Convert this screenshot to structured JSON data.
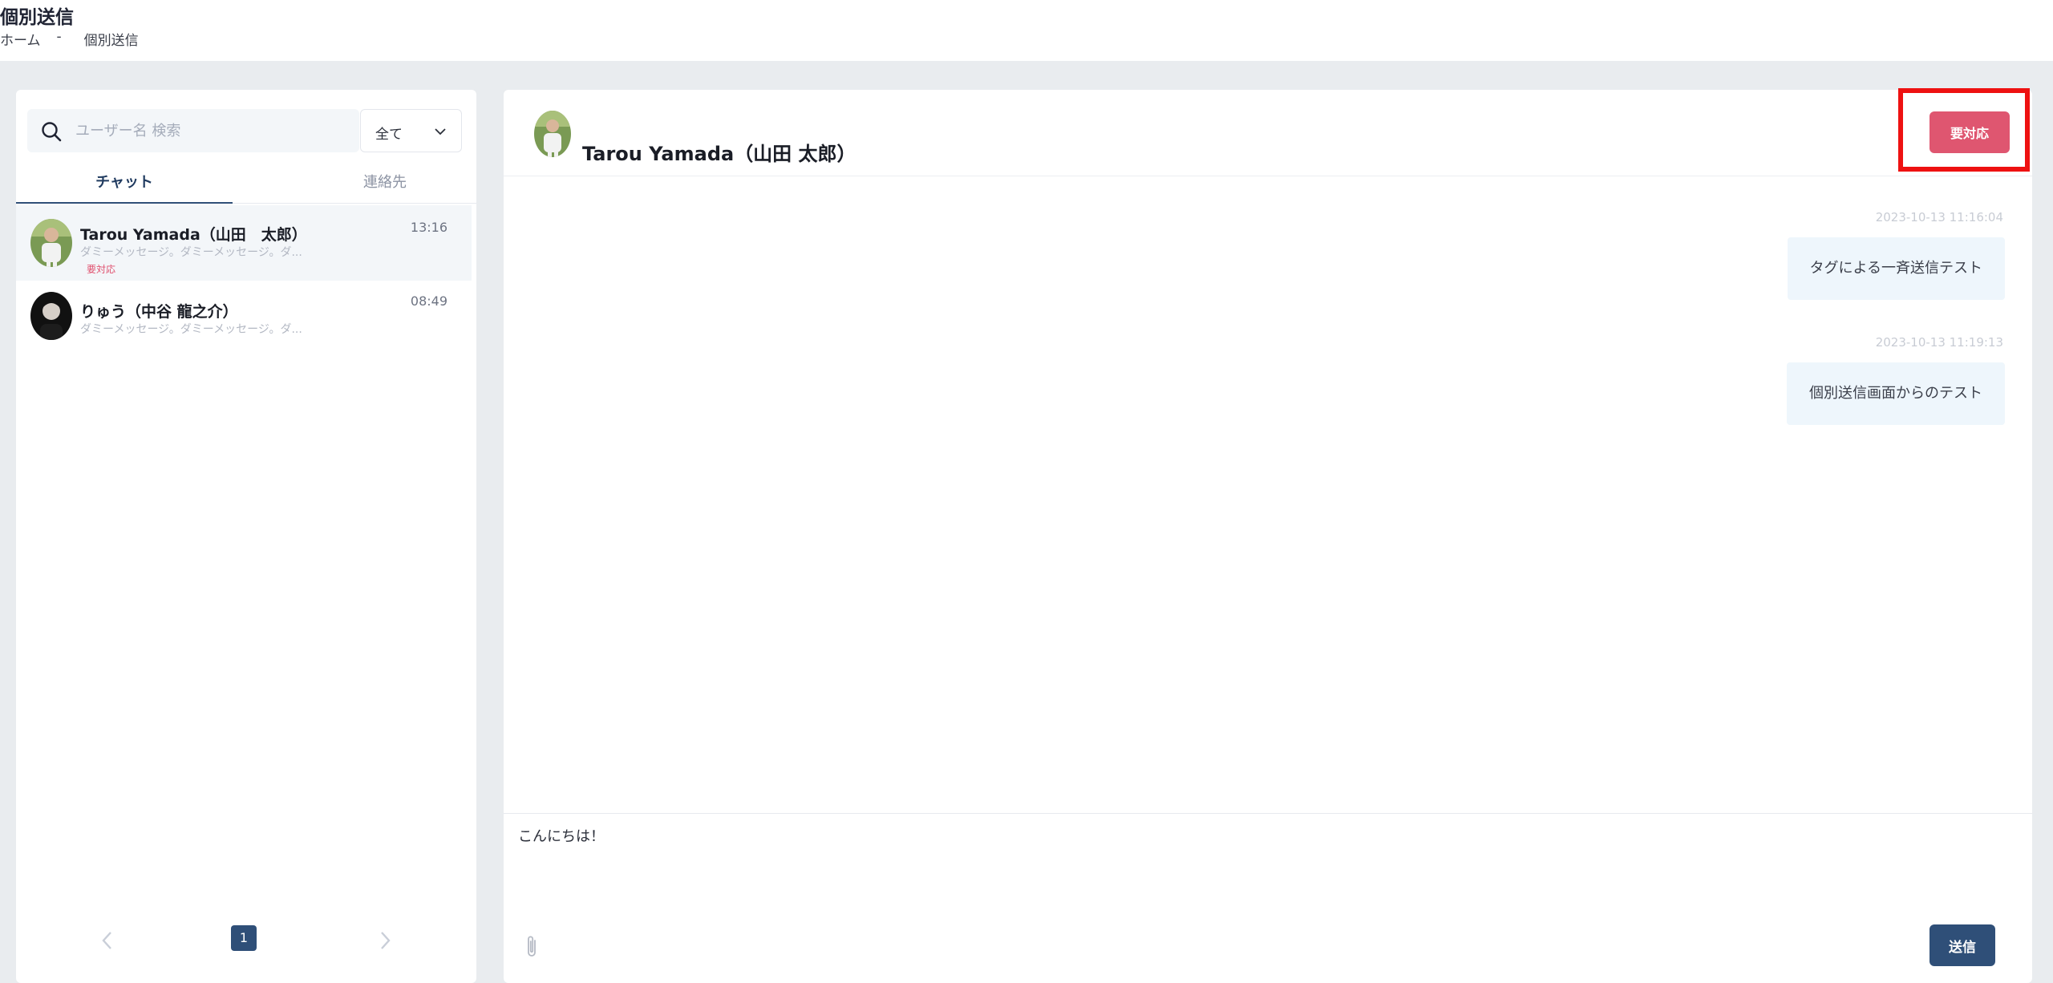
{
  "header": {
    "title": "個別送信",
    "breadcrumb": {
      "home": "ホーム",
      "separator": "-",
      "current": "個別送信"
    }
  },
  "sidebar": {
    "search": {
      "placeholder": "ユーザー名 検索",
      "value": ""
    },
    "filter": {
      "selected": "全て"
    },
    "tabs": [
      {
        "label": "チャット",
        "active": true
      },
      {
        "label": "連絡先",
        "active": false
      }
    ],
    "chats": [
      {
        "name": "Tarou Yamada（山田　太郎）",
        "preview": "ダミーメッセージ。ダミーメッセージ。ダ...",
        "time": "13:16",
        "badge": "要対応",
        "selected": true
      },
      {
        "name": "りゅう（中谷 龍之介）",
        "preview": "ダミーメッセージ。ダミーメッセージ。ダ...",
        "time": "08:49",
        "badge": "",
        "selected": false
      }
    ],
    "pagination": {
      "current_page": "1"
    }
  },
  "conversation": {
    "contact_name": "Tarou Yamada（山田 太郎）",
    "status_button": "要対応",
    "messages": [
      {
        "timestamp": "2023-10-13 11:16:04",
        "text": "タグによる一斉送信テスト"
      },
      {
        "timestamp": "2023-10-13 11:19:13",
        "text": "個別送信画面からのテスト"
      }
    ],
    "composer": {
      "value": "こんにちは！"
    },
    "send_button": "送信"
  },
  "colors": {
    "accent": "#2f4f78",
    "urgent": "#df5670",
    "highlight": "#ee1111",
    "bubble": "#eef6fc"
  }
}
